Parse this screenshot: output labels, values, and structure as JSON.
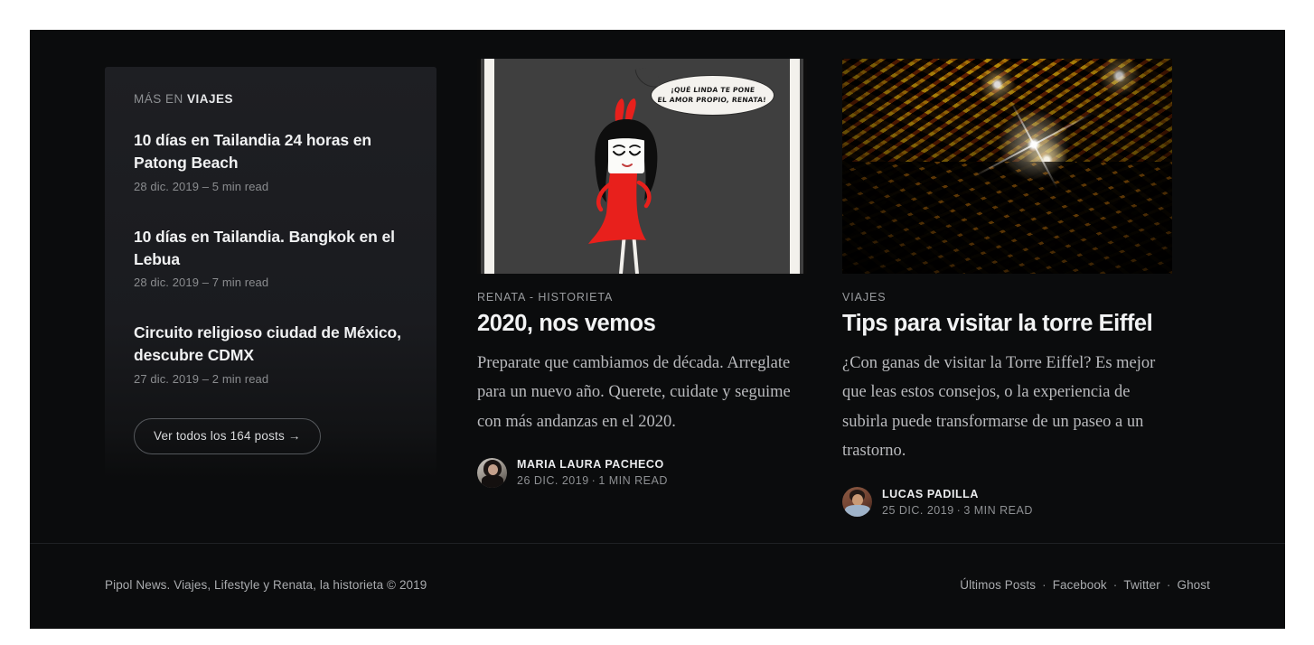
{
  "sidebar": {
    "more_in_prefix": "MÁS EN ",
    "more_in_tag": "VIAJES",
    "posts": [
      {
        "title": "10 días en Tailandia 24 horas en Patong Beach",
        "meta": "28 dic. 2019 – 5 min read"
      },
      {
        "title": "10 días en Tailandia. Bangkok en el Lebua",
        "meta": "28 dic. 2019 – 7 min read"
      },
      {
        "title": "Circuito religioso ciudad de México, descubre CDMX",
        "meta": "27 dic. 2019 – 2 min read"
      }
    ],
    "all_posts_button": "Ver todos los 164 posts →"
  },
  "cards": [
    {
      "kicker": "RENATA - HISTORIETA",
      "title": "2020, nos vemos",
      "excerpt": "Preparate que cambiamos de década. Arreglate para un nuevo año. Querete, cuidate y seguime con más andanzas en el 2020.",
      "author": "MARIA LAURA PACHECO",
      "date": "26 DIC. 2019",
      "read_time": "1 MIN READ",
      "image_alt": "comic-illustration",
      "comic_bubble_line1": "¡QUÉ LINDA TE PONE",
      "comic_bubble_line2": "EL AMOR PROPIO, RENATA!"
    },
    {
      "kicker": "VIAJES",
      "title": "Tips para visitar la torre Eiffel",
      "excerpt": "¿Con ganas de visitar la Torre Eiffel? Es mejor que leas estos consejos, o la experiencia de subirla puede transformarse de un paseo a un trastorno.",
      "author": "LUCAS PADILLA",
      "date": "25 DIC. 2019",
      "read_time": "3 MIN READ",
      "image_alt": "eiffel-tower-night-photo"
    }
  ],
  "footer": {
    "copyright": "Pipol News. Viajes, Lifestyle y Renata, la historieta © 2019",
    "links": [
      "Últimos Posts",
      "Facebook",
      "Twitter",
      "Ghost"
    ],
    "separator": "·"
  },
  "colors": {
    "page_background": "#0b0c0d",
    "card_background": "#1e1f23",
    "text_primary": "#f0f1f2",
    "text_muted": "#8a8c8f",
    "comic_red": "#e8201c",
    "eiffel_gold": "#e8ad22"
  }
}
